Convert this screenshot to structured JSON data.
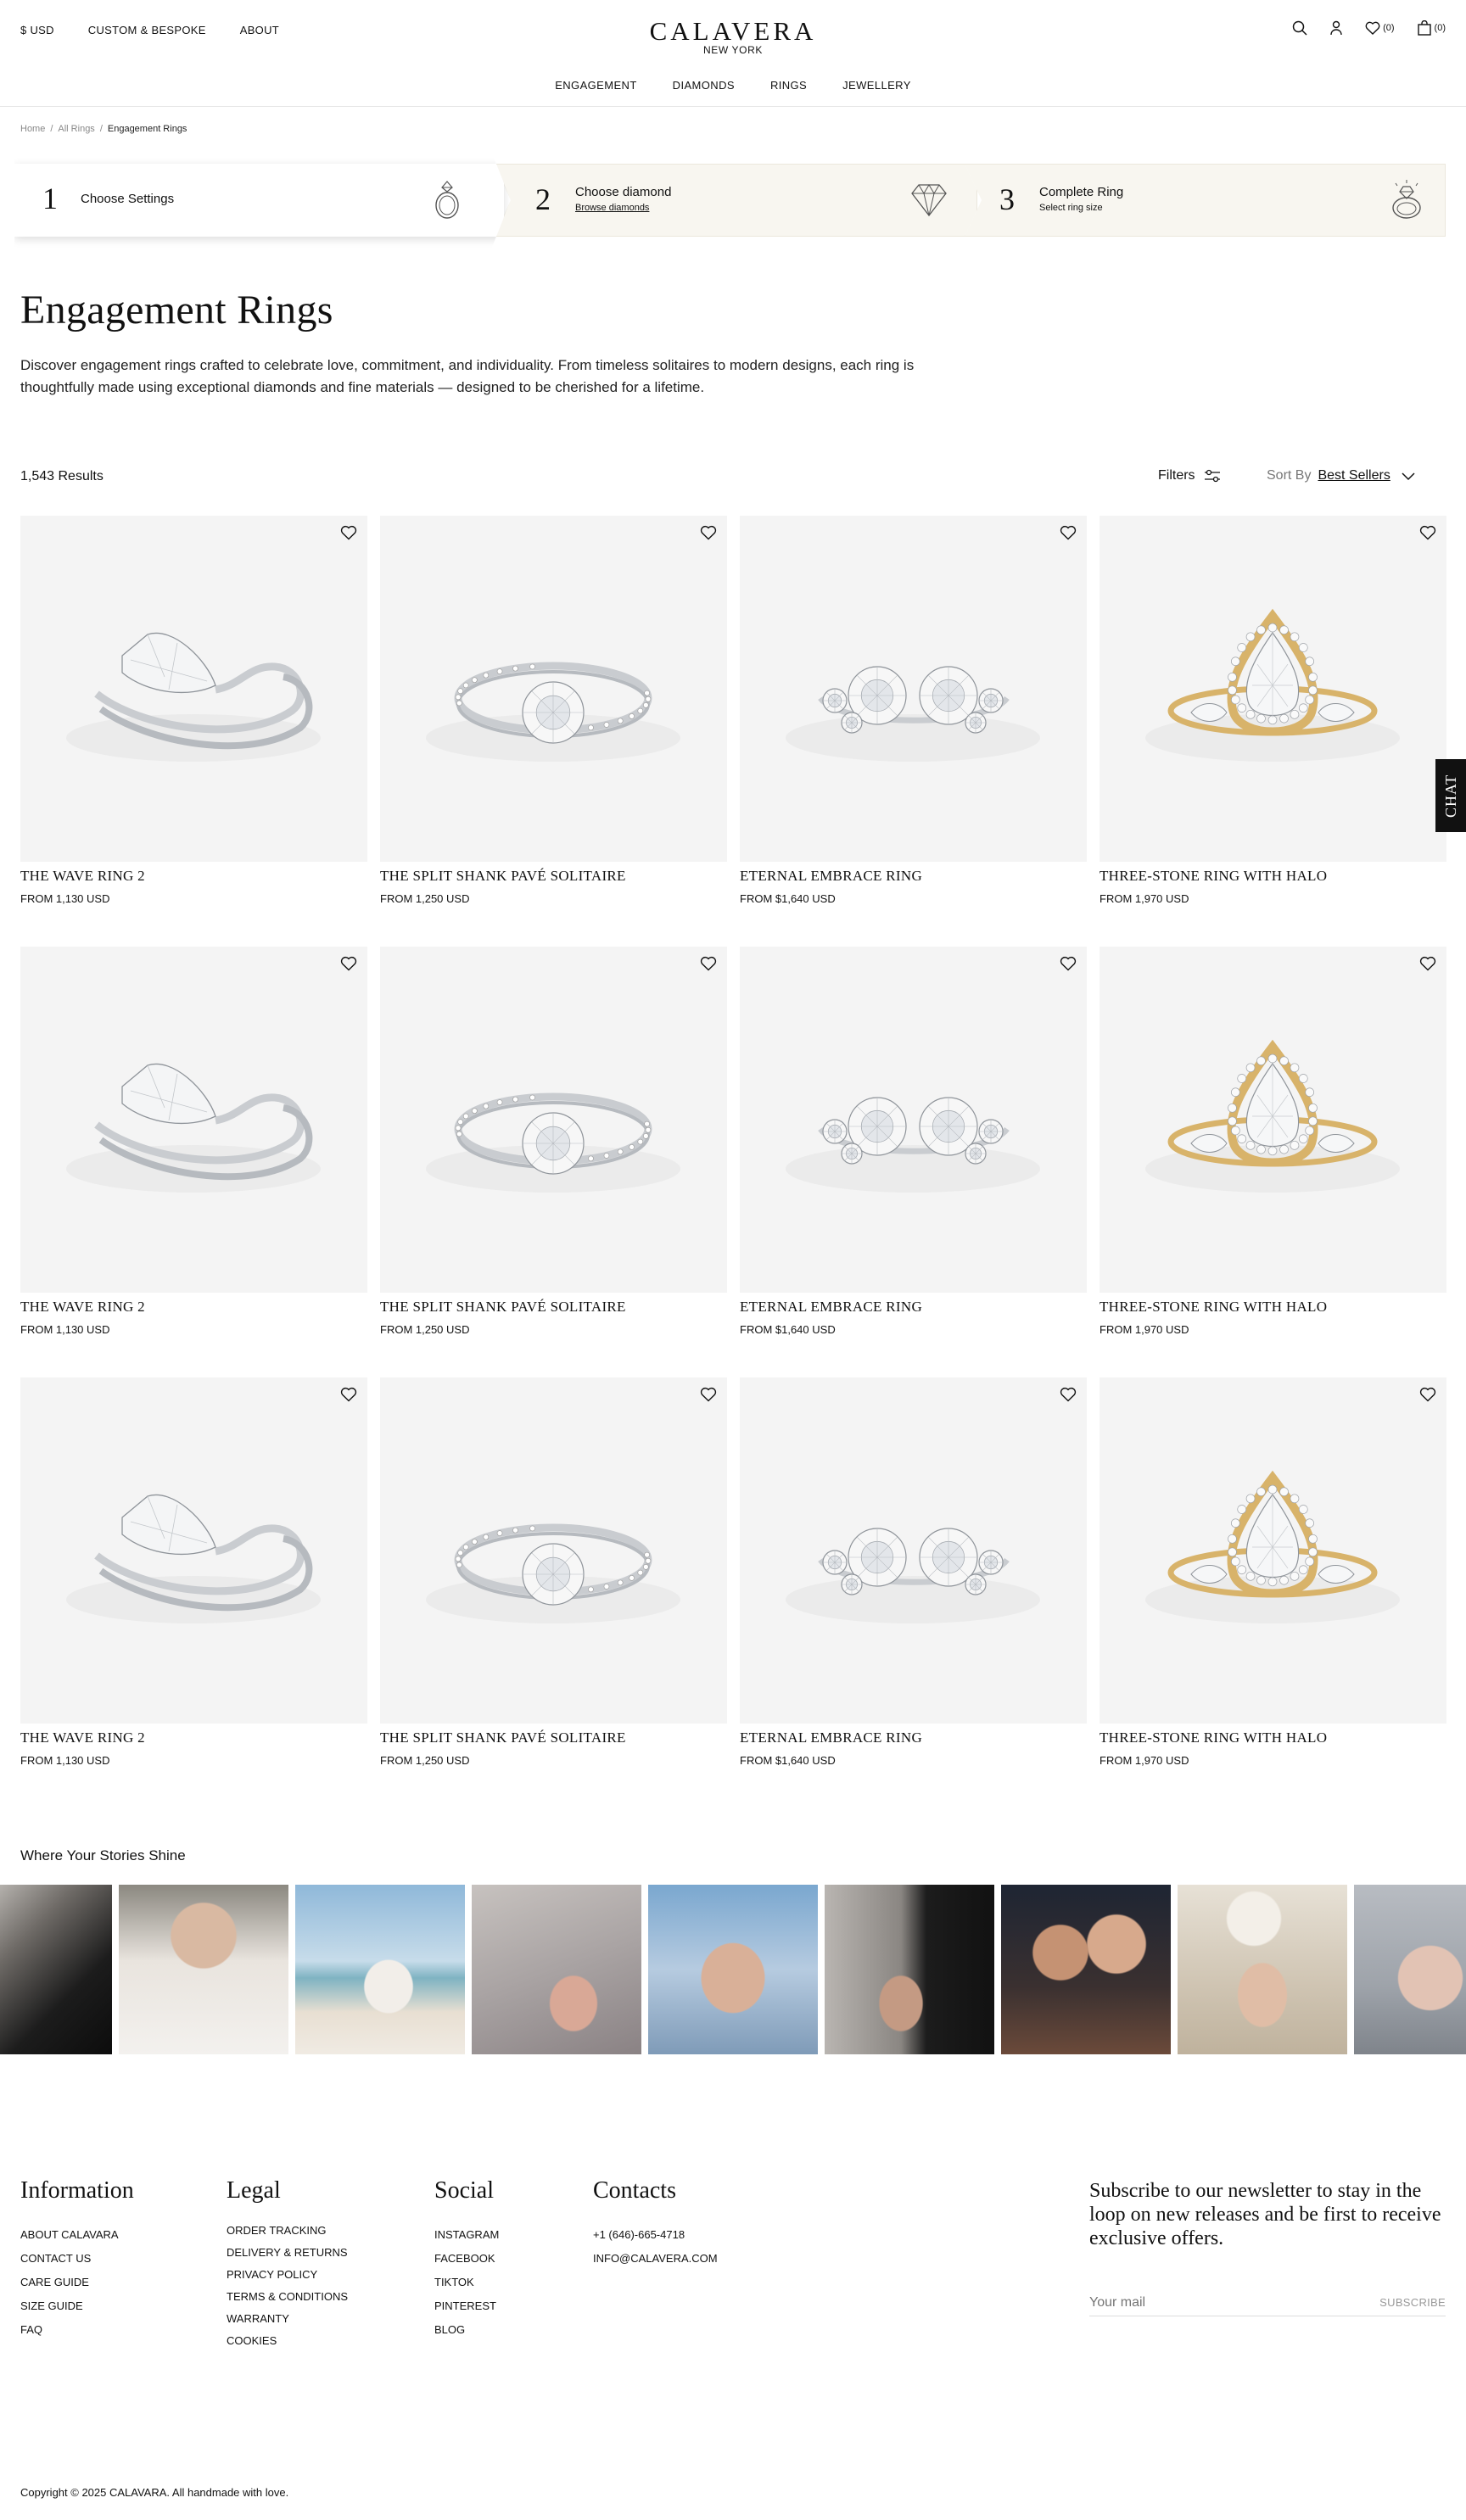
{
  "header": {
    "currency": "$ USD",
    "custom": "CUSTOM & BESPOKE",
    "about": "ABOUT",
    "brand": "CALAVERA",
    "city": "NEW YORK",
    "wishlist_count": "(0)",
    "cart_count": "(0)",
    "nav": [
      "ENGAGEMENT",
      "DIAMONDS",
      "RINGS",
      "JEWELLERY"
    ]
  },
  "breadcrumb": {
    "home": "Home",
    "sep": "/",
    "all_rings": "All Rings",
    "current": "Engagement Rings"
  },
  "steps": [
    {
      "num": "1",
      "title": "Choose Settings",
      "sub": "",
      "icon": "ring-outline-icon"
    },
    {
      "num": "2",
      "title": "Choose diamond",
      "sub": "Browse diamonds",
      "icon": "diamond-icon"
    },
    {
      "num": "3",
      "title": "Complete Ring",
      "sub": "Select ring size",
      "icon": "diamond-ring-icon"
    }
  ],
  "page": {
    "title": "Engagement Rings",
    "intro": "Discover engagement rings crafted to celebrate love, commitment, and individuality. From timeless solitaires to modern designs, each ring is thoughtfully made using exceptional diamonds and fine materials — designed to be cherished for a lifetime.",
    "results": "1,543 Results",
    "filters": "Filters",
    "sort_label": "Sort By",
    "sort_value": "Best Sellers"
  },
  "products": [
    {
      "name": "THE WAVE RING 2",
      "price": "FROM 1,130 USD",
      "style": "wave",
      "metal": "#c9ccd0"
    },
    {
      "name": "THE SPLIT SHANK PAVÉ SOLITAIRE",
      "price": "FROM 1,250 USD",
      "style": "solitaire",
      "metal": "#c9ccd0"
    },
    {
      "name": "ETERNAL EMBRACE RING",
      "price": "FROM $1,640 USD",
      "style": "toi",
      "metal": "#c9ccd0"
    },
    {
      "name": "THREE-STONE RING WITH HALO",
      "price": "FROM 1,970 USD",
      "style": "halo",
      "metal": "#d8b36a"
    },
    {
      "name": "THE WAVE RING 2",
      "price": "FROM 1,130 USD",
      "style": "wave",
      "metal": "#c9ccd0"
    },
    {
      "name": "THE SPLIT SHANK PAVÉ SOLITAIRE",
      "price": "FROM 1,250 USD",
      "style": "solitaire",
      "metal": "#c9ccd0"
    },
    {
      "name": "ETERNAL EMBRACE RING",
      "price": "FROM $1,640 USD",
      "style": "toi",
      "metal": "#c9ccd0"
    },
    {
      "name": "THREE-STONE RING WITH HALO",
      "price": "FROM 1,970 USD",
      "style": "halo",
      "metal": "#d8b36a"
    },
    {
      "name": "THE WAVE RING 2",
      "price": "FROM 1,130 USD",
      "style": "wave",
      "metal": "#c9ccd0"
    },
    {
      "name": "THE SPLIT SHANK PAVÉ SOLITAIRE",
      "price": "FROM 1,250 USD",
      "style": "solitaire",
      "metal": "#c9ccd0"
    },
    {
      "name": "ETERNAL EMBRACE RING",
      "price": "FROM $1,640 USD",
      "style": "toi",
      "metal": "#c9ccd0"
    },
    {
      "name": "THREE-STONE RING WITH HALO",
      "price": "FROM 1,970 USD",
      "style": "halo",
      "metal": "#d8b36a"
    }
  ],
  "chat": "CHAT",
  "stories": {
    "title": "Where Your Stories Shine"
  },
  "footer": {
    "information": {
      "title": "Information",
      "items": [
        "ABOUT CALAVARA",
        "CONTACT US",
        "CARE GUIDE",
        "SIZE GUIDE",
        "FAQ"
      ]
    },
    "legal": {
      "title": "Legal",
      "items": [
        "ORDER TRACKING",
        "DELIVERY & RETURNS",
        "PRIVACY POLICY",
        "TERMS & CONDITIONS",
        "WARRANTY",
        "COOKIES"
      ]
    },
    "social": {
      "title": "Social",
      "items": [
        "INSTAGRAM",
        "FACEBOOK",
        "TIKTOK",
        "PINTEREST",
        "BLOG"
      ]
    },
    "contacts": {
      "title": "Contacts",
      "items": [
        "+1 (646)-665-4718",
        "INFO@CALAVERA.COM"
      ]
    },
    "newsletter": {
      "text": "Subscribe to our newsletter to stay in the loop on new releases and be first to receive exclusive offers.",
      "placeholder": "Your mail",
      "button": "SUBSCRIBE"
    },
    "copyright": "Copyright © 2025 CALAVARA. All handmade with love."
  },
  "colors": {
    "text": "#111111",
    "step_bg": "#f8f6f0",
    "card_bg": "#f4f4f4",
    "gold": "#d8b36a"
  }
}
